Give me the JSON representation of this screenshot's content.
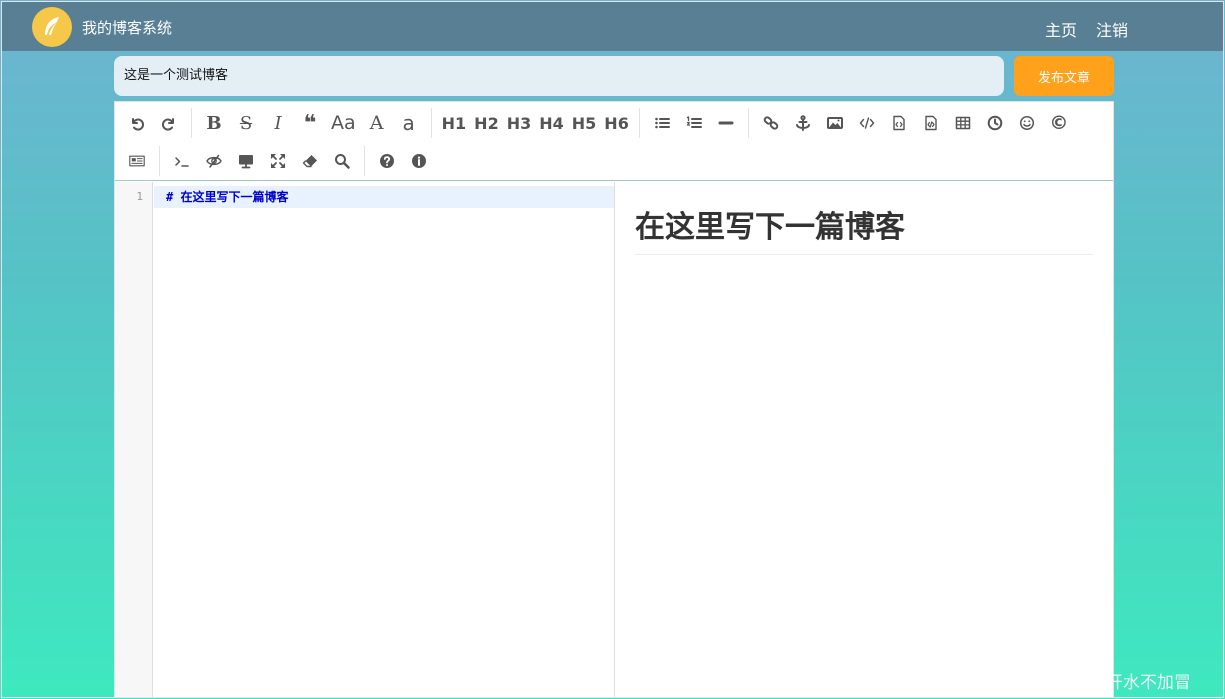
{
  "nav": {
    "site_title": "我的博客系统",
    "links": {
      "home": "主页",
      "logout": "注销"
    },
    "colors": {
      "bar": "#587f94",
      "logo": "#f6c84a"
    }
  },
  "editor_header": {
    "title_value": "这是一个测试博客",
    "publish_label": "发布文章",
    "colors": {
      "publish": "#ffa11a",
      "title_bg": "#e3eff5"
    }
  },
  "toolbar": {
    "row1": [
      {
        "name": "undo-icon",
        "type": "icon"
      },
      {
        "name": "redo-icon",
        "type": "icon"
      },
      {
        "type": "sep"
      },
      {
        "name": "bold-icon",
        "type": "text",
        "label": "B"
      },
      {
        "name": "strikethrough-icon",
        "type": "text",
        "label": "S"
      },
      {
        "name": "italic-icon",
        "type": "text",
        "label": "I"
      },
      {
        "name": "quote-icon",
        "type": "text",
        "label": "❝"
      },
      {
        "name": "case-icon",
        "type": "text",
        "label": "Aa"
      },
      {
        "name": "uppercase-icon",
        "type": "text",
        "label": "A"
      },
      {
        "name": "lowercase-icon",
        "type": "text",
        "label": "a"
      },
      {
        "type": "sep"
      },
      {
        "name": "h1-button",
        "type": "heading",
        "label": "H1"
      },
      {
        "name": "h2-button",
        "type": "heading",
        "label": "H2"
      },
      {
        "name": "h3-button",
        "type": "heading",
        "label": "H3"
      },
      {
        "name": "h4-button",
        "type": "heading",
        "label": "H4"
      },
      {
        "name": "h5-button",
        "type": "heading",
        "label": "H5"
      },
      {
        "name": "h6-button",
        "type": "heading",
        "label": "H6"
      },
      {
        "type": "sep"
      },
      {
        "name": "unordered-list-icon",
        "type": "icon"
      },
      {
        "name": "ordered-list-icon",
        "type": "icon"
      },
      {
        "name": "horizontal-rule-icon",
        "type": "icon"
      },
      {
        "type": "sep"
      },
      {
        "name": "link-icon",
        "type": "icon"
      },
      {
        "name": "anchor-icon",
        "type": "icon"
      },
      {
        "name": "image-icon",
        "type": "icon"
      },
      {
        "name": "code-icon",
        "type": "icon"
      },
      {
        "name": "preformatted-code-icon",
        "type": "icon"
      },
      {
        "name": "code-block-icon",
        "type": "icon"
      },
      {
        "name": "table-icon",
        "type": "icon"
      },
      {
        "name": "clock-icon",
        "type": "icon"
      },
      {
        "name": "emoji-icon",
        "type": "icon"
      },
      {
        "name": "copyright-icon",
        "type": "text",
        "label": "©"
      }
    ],
    "row2": [
      {
        "name": "pagebreak-icon",
        "type": "icon"
      },
      {
        "type": "sep"
      },
      {
        "name": "terminal-icon",
        "type": "icon"
      },
      {
        "name": "eye-slash-icon",
        "type": "icon"
      },
      {
        "name": "desktop-icon",
        "type": "icon"
      },
      {
        "name": "fullscreen-icon",
        "type": "icon"
      },
      {
        "name": "eraser-icon",
        "type": "icon"
      },
      {
        "name": "search-icon",
        "type": "icon"
      },
      {
        "type": "sep"
      },
      {
        "name": "help-icon",
        "type": "icon"
      },
      {
        "name": "info-icon",
        "type": "icon"
      }
    ]
  },
  "markdown": {
    "line_number": "1",
    "code_line": "# 在这里写下一篇博客",
    "preview_heading": "在这里写下一篇博客"
  },
  "watermark": "CSDN @白开水不加冒"
}
